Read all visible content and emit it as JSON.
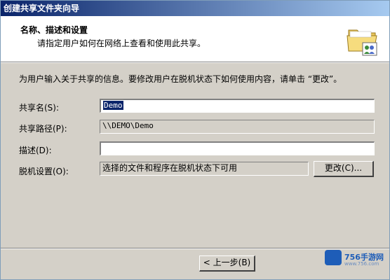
{
  "window": {
    "title": "创建共享文件夹向导"
  },
  "header": {
    "title": "名称、描述和设置",
    "subtitle": "请指定用户如何在网络上查看和使用此共享。"
  },
  "intro_text": "为用户输入关于共享的信息。要修改用户在脱机状态下如何使用内容，请单击 “更改”。",
  "fields": {
    "share_name": {
      "label": "共享名(S):",
      "value": "Demo"
    },
    "share_path": {
      "label": "共享路径(P):",
      "value": "\\\\DEMO\\Demo"
    },
    "description": {
      "label": "描述(D):",
      "value": ""
    },
    "offline": {
      "label": "脱机设置(O):",
      "value": "选择的文件和程序在脱机状态下可用"
    }
  },
  "buttons": {
    "change": "更改(C)...",
    "back": "< 上一步(B)"
  },
  "watermark": {
    "name": "756手游网",
    "url": "www.756.com"
  },
  "colors": {
    "window_bg": "#d4d0c8",
    "title_gradient_start": "#0a246a",
    "title_gradient_end": "#a6caf0",
    "selection": "#0a246a",
    "watermark_blue": "#1e5db8"
  }
}
